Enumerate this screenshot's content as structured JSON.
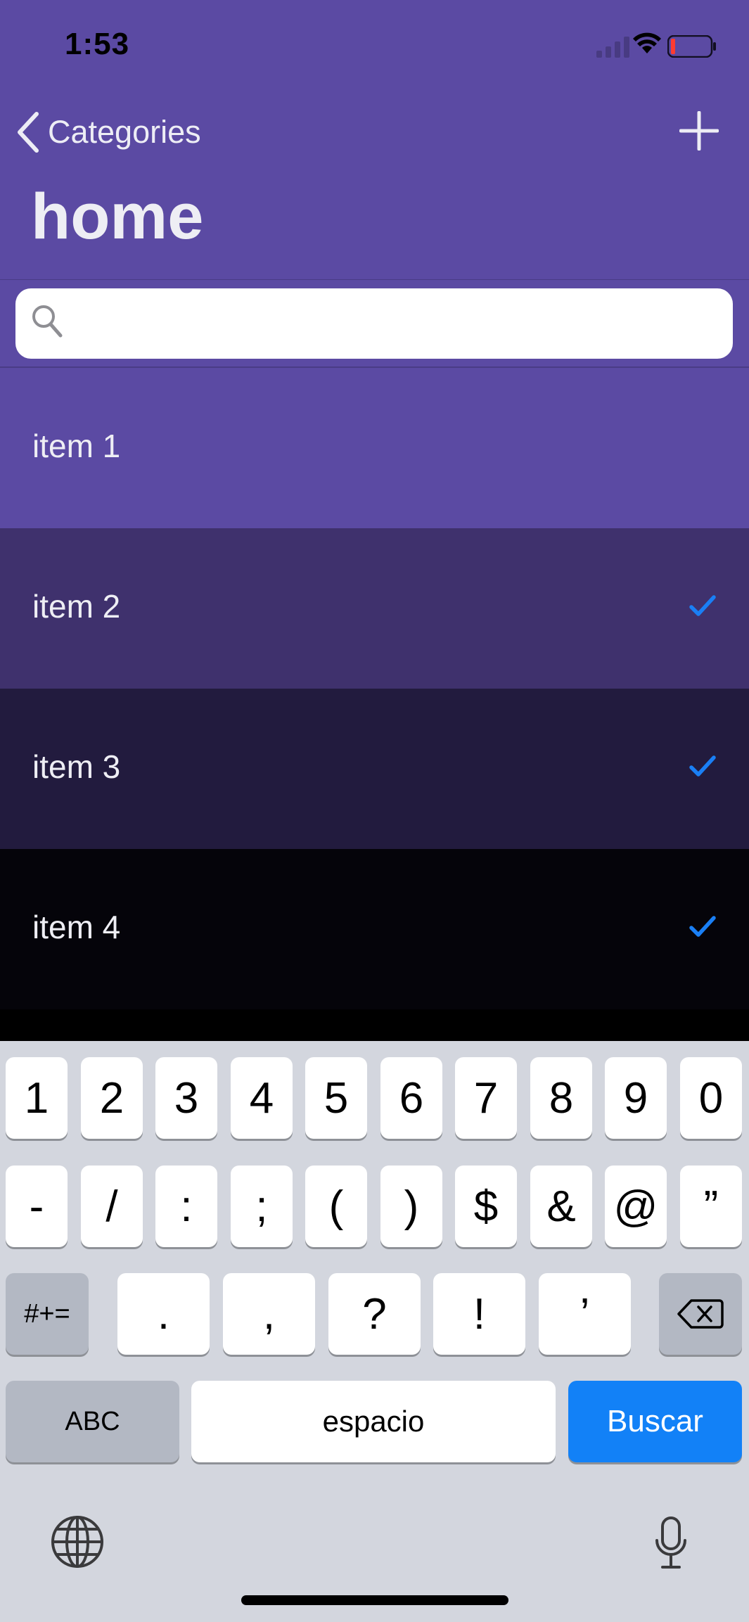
{
  "status_bar": {
    "time": "1:53"
  },
  "nav": {
    "back_label": "Categories",
    "title": "home"
  },
  "search": {
    "placeholder": "",
    "value": ""
  },
  "items": [
    {
      "label": "item 1",
      "checked": false,
      "color": "#5b4aa3"
    },
    {
      "label": "item 2",
      "checked": true,
      "color": "#3f316d"
    },
    {
      "label": "item 3",
      "checked": true,
      "color": "#221b3e"
    },
    {
      "label": "item 4",
      "checked": true,
      "color": "#05040a"
    }
  ],
  "keyboard": {
    "row1": [
      "1",
      "2",
      "3",
      "4",
      "5",
      "6",
      "7",
      "8",
      "9",
      "0"
    ],
    "row2": [
      "-",
      "/",
      ":",
      ";",
      "(",
      ")",
      "$",
      "&",
      "@",
      "”"
    ],
    "row3_left": "#+=",
    "row3": [
      ".",
      ",",
      "?",
      "!",
      "’"
    ],
    "abc": "ABC",
    "space": "espacio",
    "search_key": "Buscar"
  },
  "colors": {
    "header": "#5b4aa3",
    "accent_check": "#1a7ff5",
    "keyboard_bg": "#d3d6de",
    "search_key": "#1281f7"
  }
}
